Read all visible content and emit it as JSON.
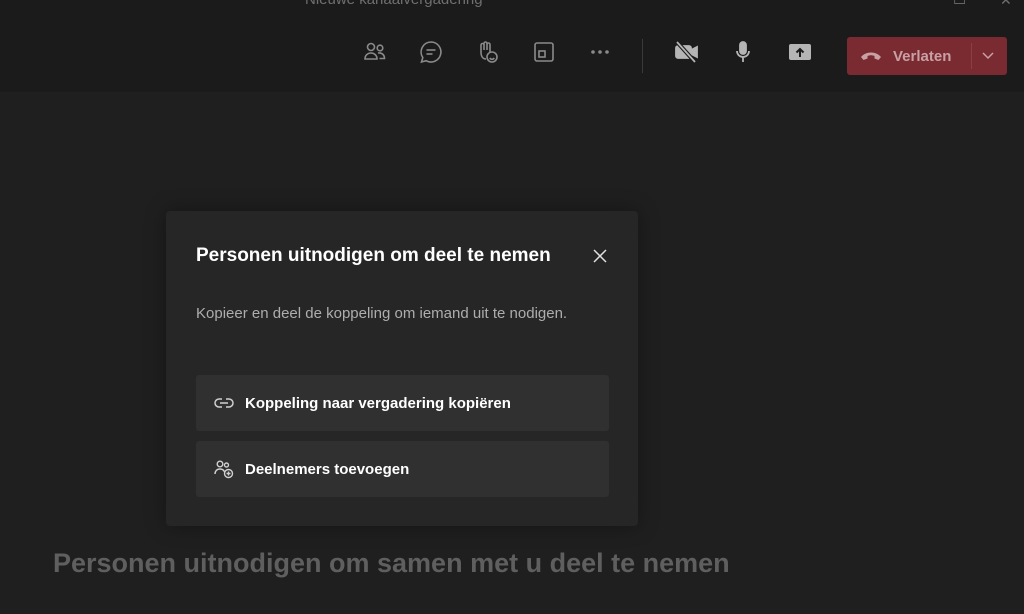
{
  "window": {
    "title": "Nieuwe kanaalvergadering"
  },
  "toolbar": {
    "buttons": [
      {
        "name": "participants",
        "icon": "people-icon"
      },
      {
        "name": "chat",
        "icon": "chat-icon"
      },
      {
        "name": "raise-hand",
        "icon": "raise-hand-icon"
      },
      {
        "name": "rooms",
        "icon": "breakout-rooms-icon"
      },
      {
        "name": "more",
        "icon": "more-icon"
      },
      {
        "name": "camera",
        "icon": "camera-off-icon"
      },
      {
        "name": "mic",
        "icon": "microphone-icon"
      },
      {
        "name": "share",
        "icon": "share-screen-icon"
      }
    ],
    "leave_label": "Verlaten",
    "leave_color": "#7a2a31"
  },
  "dialog": {
    "title": "Personen uitnodigen om deel te nemen",
    "description": "Kopieer en deel de koppeling om iemand uit te nodigen.",
    "options": [
      {
        "label": "Koppeling naar vergadering kopiëren",
        "icon": "link-icon"
      },
      {
        "label": "Deelnemers toevoegen",
        "icon": "add-people-icon"
      }
    ]
  },
  "background": {
    "invite_text": "Personen uitnodigen om samen met u deel te nemen"
  }
}
